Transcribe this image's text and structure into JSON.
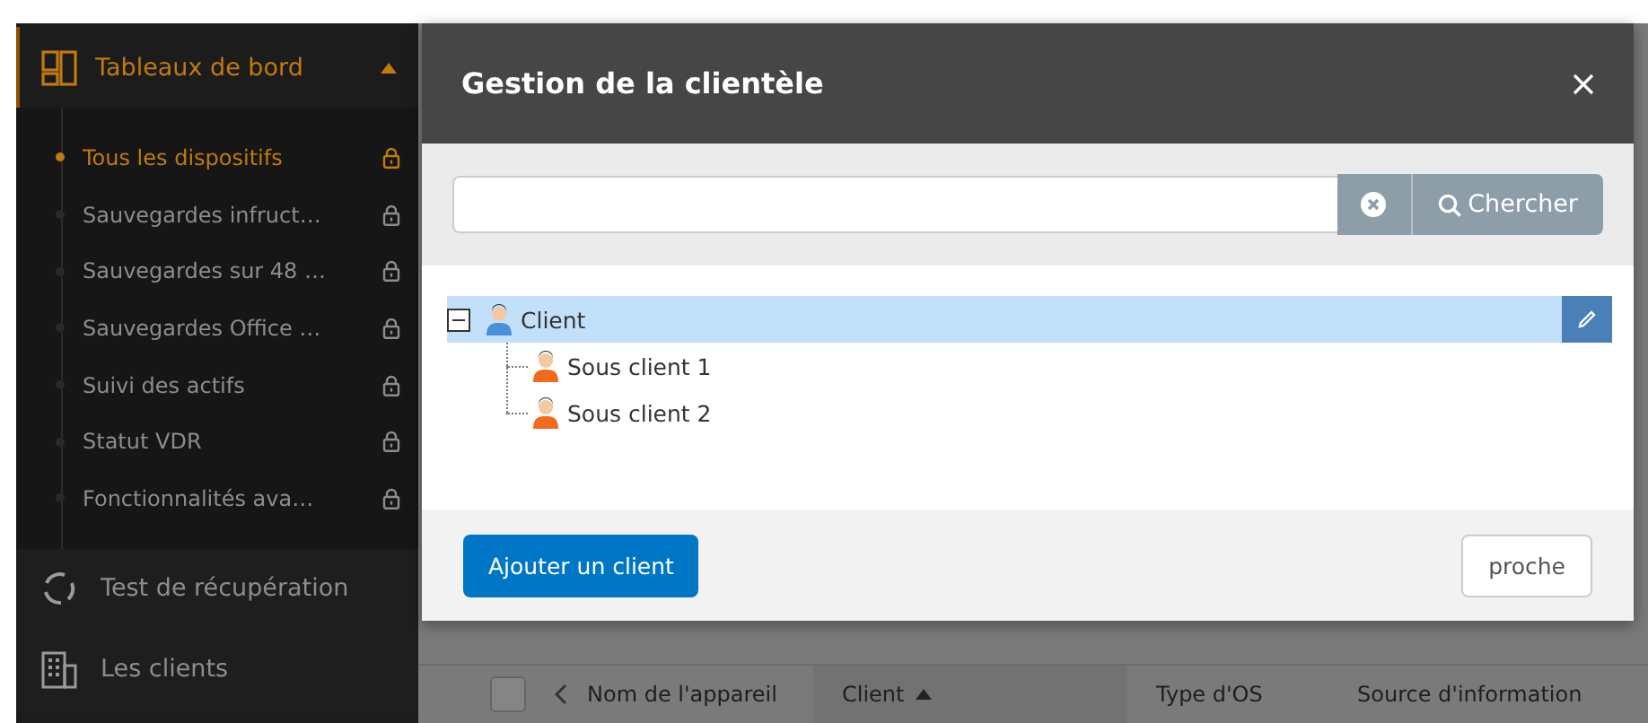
{
  "sidebar": {
    "section": {
      "label": "Tableaux de bord",
      "expanded": true,
      "items": [
        {
          "label": "Tous les dispositifs",
          "selected": true,
          "locked": true
        },
        {
          "label": "Sauvegardes infruct…",
          "selected": false,
          "locked": true
        },
        {
          "label": "Sauvegardes sur 48 …",
          "selected": false,
          "locked": true
        },
        {
          "label": "Sauvegardes Office …",
          "selected": false,
          "locked": true
        },
        {
          "label": "Suivi des actifs",
          "selected": false,
          "locked": true
        },
        {
          "label": "Statut VDR",
          "selected": false,
          "locked": true
        },
        {
          "label": "Fonctionnalités ava…",
          "selected": false,
          "locked": true
        }
      ]
    },
    "items": [
      {
        "label": "Test de récupération",
        "kind": "recovery"
      },
      {
        "label": "Les clients",
        "kind": "clients"
      }
    ]
  },
  "table": {
    "select_all": {
      "checked": false
    },
    "columns": [
      {
        "label": "Nom de l'appareil",
        "sorted": false
      },
      {
        "label": "Client",
        "sorted": true
      },
      {
        "label": "Type d'OS",
        "sorted": false
      },
      {
        "label": "Source d'information",
        "sorted": false
      }
    ]
  },
  "dialog": {
    "title": "Gestion de la clientèle",
    "search_button": "Chercher",
    "tree": [
      {
        "label": "Client",
        "kind": "client",
        "selected": true,
        "expanded": true,
        "children": [
          {
            "label": "Sous client 1",
            "kind": "subclient",
            "selected": false
          },
          {
            "label": "Sous client 2",
            "kind": "subclient",
            "selected": false
          }
        ]
      }
    ],
    "buttons": [
      {
        "label": "Ajouter un client",
        "kind": "primary"
      },
      {
        "label": "proche",
        "kind": "secondary"
      }
    ]
  }
}
